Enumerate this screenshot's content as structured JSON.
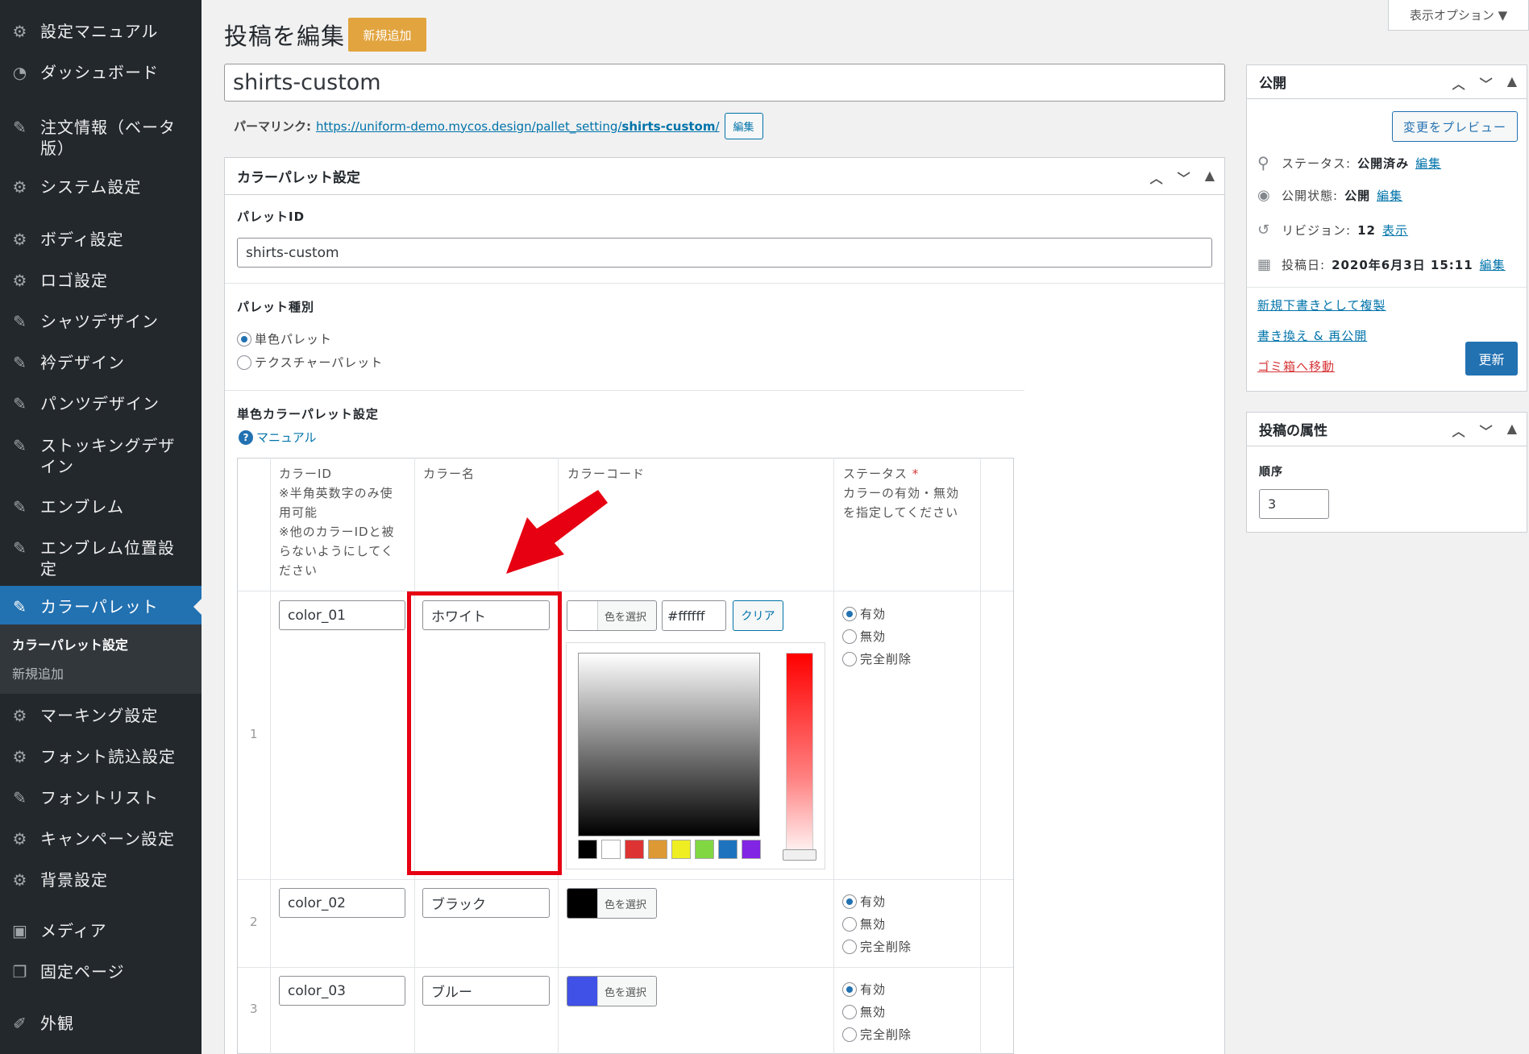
{
  "sidebar": {
    "items": [
      {
        "label": "設定マニュアル",
        "icon": "gear-icon"
      },
      {
        "label": "ダッシュボード",
        "icon": "dashboard-icon"
      },
      {
        "label": "注文情報（ベータ版）",
        "icon": "pin-icon"
      },
      {
        "label": "システム設定",
        "icon": "gear-icon"
      },
      {
        "label": "ボディ設定",
        "icon": "gear-icon"
      },
      {
        "label": "ロゴ設定",
        "icon": "gear-icon"
      },
      {
        "label": "シャツデザイン",
        "icon": "pin-icon"
      },
      {
        "label": "衿デザイン",
        "icon": "pin-icon"
      },
      {
        "label": "パンツデザイン",
        "icon": "pin-icon"
      },
      {
        "label": "ストッキングデザイン",
        "icon": "pin-icon"
      },
      {
        "label": "エンブレム",
        "icon": "pin-icon"
      },
      {
        "label": "エンブレム位置設定",
        "icon": "pin-icon"
      },
      {
        "label": "カラーパレット",
        "icon": "pin-icon"
      },
      {
        "label": "マーキング設定",
        "icon": "gear-icon"
      },
      {
        "label": "フォント読込設定",
        "icon": "gear-icon"
      },
      {
        "label": "フォントリスト",
        "icon": "pin-icon"
      },
      {
        "label": "キャンペーン設定",
        "icon": "gear-icon"
      },
      {
        "label": "背景設定",
        "icon": "gear-icon"
      },
      {
        "label": "メディア",
        "icon": "media-icon"
      },
      {
        "label": "固定ページ",
        "icon": "pages-icon"
      },
      {
        "label": "外観",
        "icon": "appearance-icon"
      }
    ],
    "submenu": [
      "カラーパレット設定",
      "新規追加"
    ]
  },
  "header": {
    "title": "投稿を編集",
    "add_new": "新規追加",
    "screen_options": "表示オプション ▼"
  },
  "post": {
    "title": "shirts-custom",
    "permalink_label": "パーマリンク:",
    "permalink_base": "https://uniform-demo.mycos.design/pallet_setting/",
    "permalink_slug": "shirts-custom",
    "permalink_tail": "/",
    "permalink_edit": "編集"
  },
  "palette_box": {
    "title": "カラーパレット設定",
    "id_label": "パレットID",
    "id_value": "shirts-custom",
    "type_label": "パレット種別",
    "type_options": [
      "単色パレット",
      "テクスチャーパレット"
    ],
    "type_selected": 0,
    "single_label": "単色カラーパレット設定",
    "manual_link": "マニュアル"
  },
  "table": {
    "headers": {
      "id": "カラーID",
      "id_note": [
        "※半角英数字のみ使",
        "用可能",
        "※他のカラーIDと被",
        "らないようにしてく",
        "ださい"
      ],
      "name": "カラー名",
      "code": "カラーコード",
      "status": "ステータス",
      "status_required": "*",
      "status_note": [
        "カラーの有効・無効",
        "を指定してください"
      ]
    },
    "choose_color": "色を選択",
    "clear": "クリア",
    "status_options": [
      "有効",
      "無効",
      "完全削除"
    ],
    "rows": [
      {
        "num": "1",
        "id": "color_01",
        "name": "ホワイト",
        "hex": "#ffffff",
        "swatch": "#ffffff"
      },
      {
        "num": "2",
        "id": "color_02",
        "name": "ブラック",
        "swatch": "#000000"
      },
      {
        "num": "3",
        "id": "color_03",
        "name": "ブルー",
        "swatch": "#3f51e6"
      }
    ],
    "picker_palette": [
      "#000000",
      "#ffffff",
      "#dd3333",
      "#dd9933",
      "#eeee22",
      "#81d742",
      "#1e73be",
      "#8224e3"
    ]
  },
  "publish": {
    "title": "公開",
    "preview": "変更をプレビュー",
    "status_label": "ステータス:",
    "status_value": "公開済み",
    "visibility_label": "公開状態:",
    "visibility_value": "公開",
    "revisions_label": "リビジョン:",
    "revisions_value": "12",
    "revisions_link": "表示",
    "date_label": "投稿日:",
    "date_value": "2020年6月3日 15:11",
    "edit": "編集",
    "duplicate": "新規下書きとして複製",
    "rewrite": "書き換え & 再公開",
    "trash": "ゴミ箱へ移動",
    "update": "更新"
  },
  "attributes": {
    "title": "投稿の属性",
    "order_label": "順序",
    "order_value": "3"
  }
}
